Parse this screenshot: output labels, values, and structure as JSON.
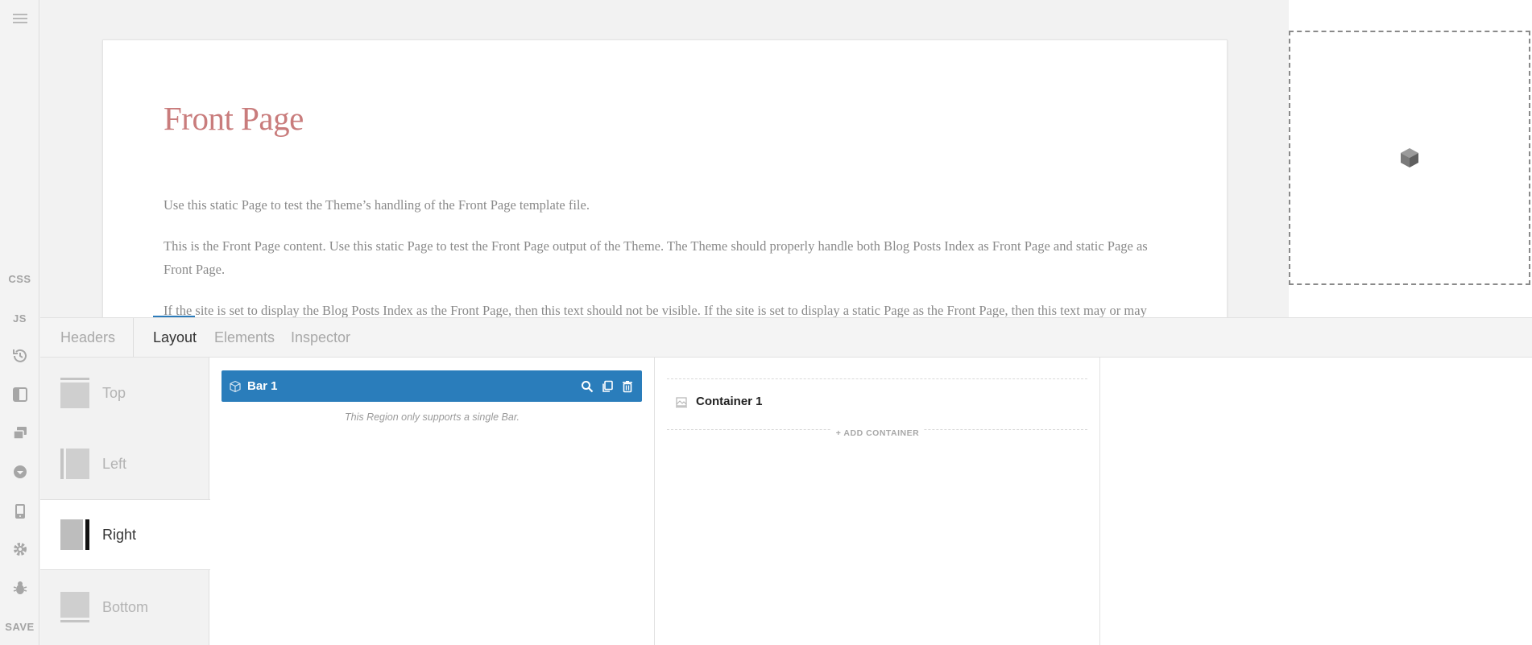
{
  "rail": {
    "css_label": "CSS",
    "js_label": "JS",
    "save_label": "SAVE"
  },
  "preview": {
    "page_title": "Front Page",
    "paragraphs": [
      "Use this static Page to test the Theme’s handling of the Front Page template file.",
      "This is the Front Page content. Use this static Page to test the Front Page output of the Theme. The Theme should properly handle both Blog Posts Index as Front Page and static Page as Front Page.",
      "If the site is set to display the Blog Posts Index as the Front Page, then this text should not be visible. If the site is set to display a static Page as the Front Page, then this text may or may not be visible. If the Theme does not include a front-page.php template file, then this text should appear on the Front Page when set to display a static Page. If the Theme does include a front-page.php template file, then this text may or may not appear."
    ]
  },
  "tabs": {
    "headers": "Headers",
    "layout": "Layout",
    "elements": "Elements",
    "inspector": "Inspector"
  },
  "regions": {
    "top": "Top",
    "left": "Left",
    "right": "Right",
    "bottom": "Bottom",
    "active": "Right"
  },
  "bars": {
    "bar_1": "Bar 1",
    "note": "This Region only supports a single Bar."
  },
  "containers": {
    "container_1": "Container 1",
    "add_label": "ADD CONTAINER"
  },
  "colors": {
    "accent": "#2a7dbb",
    "title": "#c97c7c"
  }
}
